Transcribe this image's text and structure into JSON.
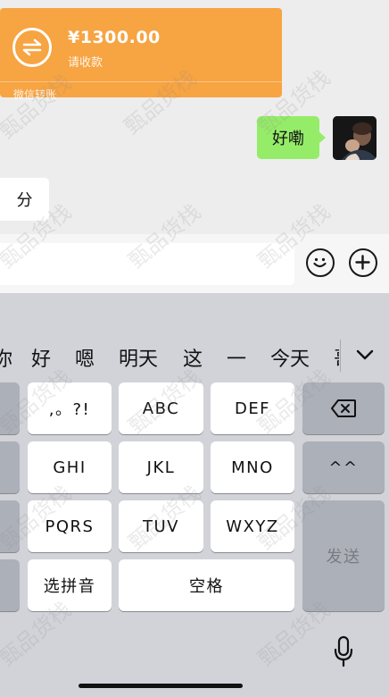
{
  "transfer": {
    "amount": "¥1300.00",
    "subtitle": "请收款",
    "footer": "微信转账",
    "color": "#f7a442"
  },
  "messages": {
    "sent": "好嘞",
    "received": "分"
  },
  "input_bar": {
    "emoji_icon": "emoji-icon",
    "plus_icon": "plus-icon"
  },
  "candidates": {
    "items": [
      "你",
      "好",
      "嗯",
      "明天",
      "这",
      "一",
      "今天",
      "哥"
    ],
    "collapse_icon": "chevron-down-icon"
  },
  "keyboard": {
    "row1": [
      ",。?!",
      "ABC",
      "DEF"
    ],
    "row2": [
      "GHI",
      "JKL",
      "MNO"
    ],
    "row3": [
      "PQRS",
      "TUV",
      "WXYZ"
    ],
    "emoticon": "^^",
    "send": "发送",
    "pinyin_select": "选拼音",
    "space": "空格",
    "mic_icon": "microphone-icon",
    "backspace_icon": "backspace-icon"
  },
  "watermark": "甄品货栈"
}
